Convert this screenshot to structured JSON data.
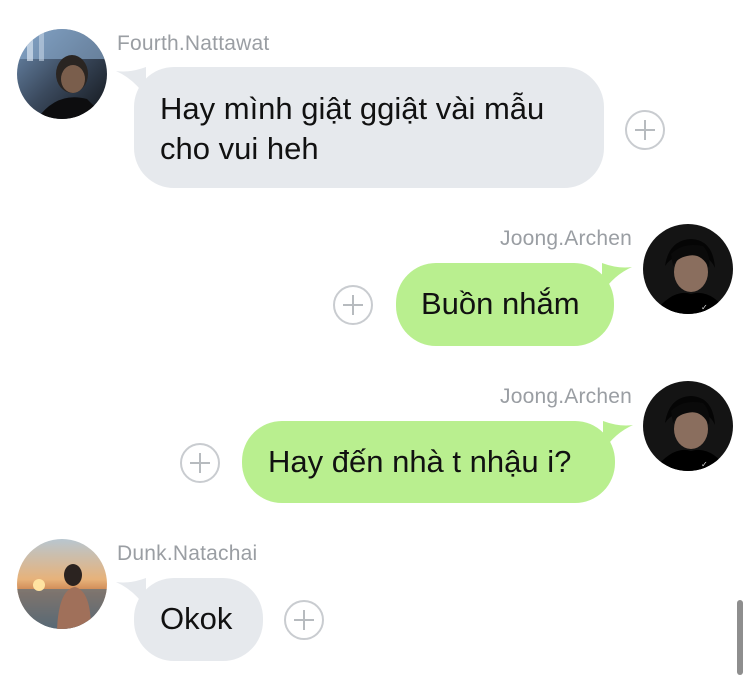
{
  "messages": [
    {
      "sender": "Fourth.Nattawat",
      "text_lines": [
        "Hay mình giật ggiật vài mẫu",
        "cho vui heh"
      ],
      "direction": "incoming"
    },
    {
      "sender": "Joong.Archen",
      "text_lines": [
        "Buồn nhắm"
      ],
      "direction": "outgoing"
    },
    {
      "sender": "Joong.Archen",
      "text_lines": [
        "Hay đến nhà t nhậu i?"
      ],
      "direction": "outgoing"
    },
    {
      "sender": "Dunk.Natachai",
      "text_lines": [
        "Okok"
      ],
      "direction": "incoming"
    }
  ],
  "icons": {
    "reaction": "add-reaction-icon",
    "avatar": "avatar-photo"
  },
  "colors": {
    "incoming_bubble": "#e6e9ed",
    "outgoing_bubble": "#b9ef8f",
    "sender_name": "#9a9ea3",
    "message_text": "#111111",
    "reaction_border": "#c9ccd0"
  }
}
